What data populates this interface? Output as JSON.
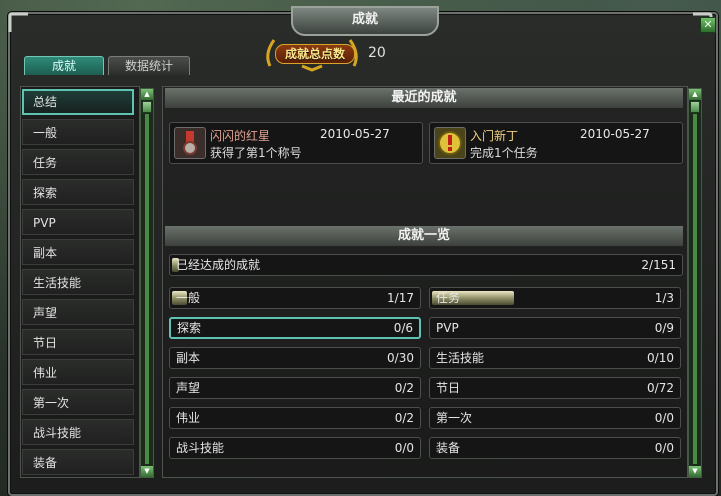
{
  "window": {
    "title": "成就",
    "close_glyph": "✕"
  },
  "header": {
    "badge_label": "成就总点数",
    "points": "20"
  },
  "tabs": [
    {
      "label": "成就",
      "active": true
    },
    {
      "label": "数据统计",
      "active": false
    }
  ],
  "sidebar": {
    "items": [
      {
        "label": "总结",
        "selected": true
      },
      {
        "label": "一般"
      },
      {
        "label": "任务"
      },
      {
        "label": "探索"
      },
      {
        "label": "PVP"
      },
      {
        "label": "副本"
      },
      {
        "label": "生活技能"
      },
      {
        "label": "声望"
      },
      {
        "label": "节日"
      },
      {
        "label": "伟业"
      },
      {
        "label": "第一次"
      },
      {
        "label": "战斗技能"
      },
      {
        "label": "装备"
      }
    ]
  },
  "recent": {
    "heading": "最近的成就",
    "items": [
      {
        "title": "闪闪的红星",
        "date": "2010-05-27",
        "desc": "获得了第1个称号",
        "icon": "red-medal-icon"
      },
      {
        "title": "入门新丁",
        "date": "2010-05-27",
        "desc": "完成1个任务",
        "icon": "exclamation-icon"
      }
    ]
  },
  "overview": {
    "heading": "成就一览",
    "overall": {
      "label": "已经达成的成就",
      "value": "2/151",
      "progress": 0.013
    },
    "categories": [
      {
        "label": "一般",
        "value": "1/17",
        "progress": 0.059
      },
      {
        "label": "任务",
        "value": "1/3",
        "progress": 0.333
      },
      {
        "label": "探索",
        "value": "0/6",
        "progress": 0,
        "selected": true
      },
      {
        "label": "PVP",
        "value": "0/9",
        "progress": 0
      },
      {
        "label": "副本",
        "value": "0/30",
        "progress": 0
      },
      {
        "label": "生活技能",
        "value": "0/10",
        "progress": 0
      },
      {
        "label": "声望",
        "value": "0/2",
        "progress": 0
      },
      {
        "label": "节日",
        "value": "0/72",
        "progress": 0
      },
      {
        "label": "伟业",
        "value": "0/2",
        "progress": 0
      },
      {
        "label": "第一次",
        "value": "0/0",
        "progress": 0
      },
      {
        "label": "战斗技能",
        "value": "0/0",
        "progress": 0
      },
      {
        "label": "装备",
        "value": "0/0",
        "progress": 0
      }
    ]
  },
  "colors": {
    "accent_teal": "#5fc3b2",
    "gold": "#ffe58a",
    "progress_fill": "#ece7c4"
  }
}
